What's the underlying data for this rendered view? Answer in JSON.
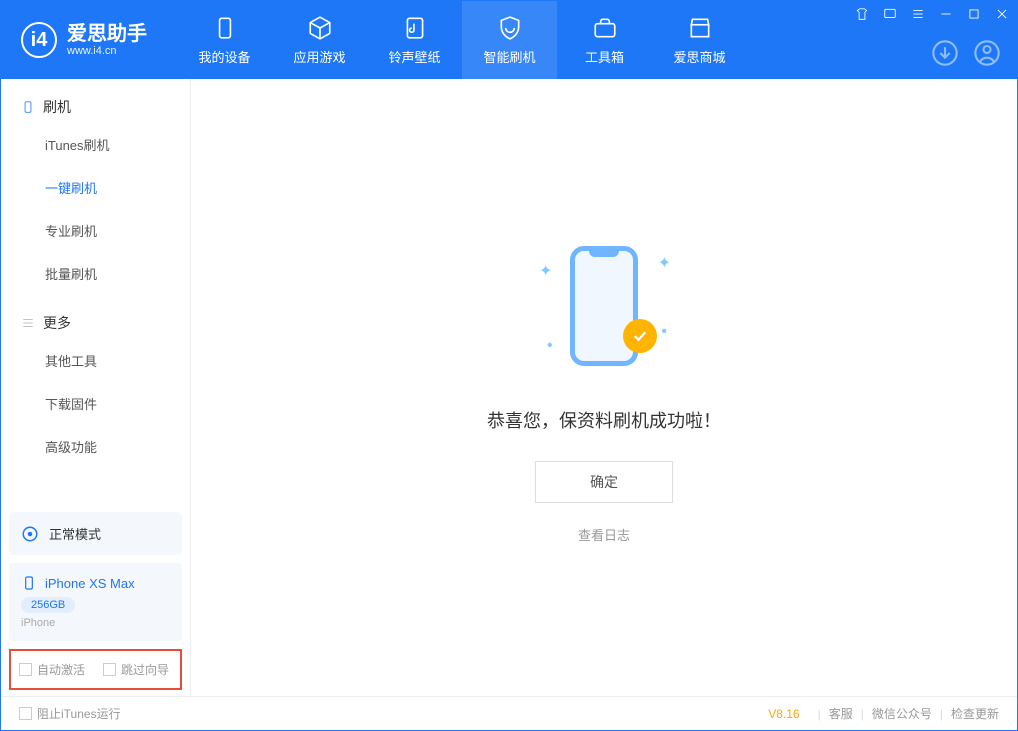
{
  "app": {
    "name": "爱思助手",
    "url": "www.i4.cn"
  },
  "tabs": [
    {
      "label": "我的设备"
    },
    {
      "label": "应用游戏"
    },
    {
      "label": "铃声壁纸"
    },
    {
      "label": "智能刷机"
    },
    {
      "label": "工具箱"
    },
    {
      "label": "爱思商城"
    }
  ],
  "sidebar": {
    "flash": {
      "title": "刷机",
      "items": [
        "iTunes刷机",
        "一键刷机",
        "专业刷机",
        "批量刷机"
      ]
    },
    "more": {
      "title": "更多",
      "items": [
        "其他工具",
        "下载固件",
        "高级功能"
      ]
    },
    "mode": "正常模式",
    "device": {
      "name": "iPhone XS Max",
      "storage": "256GB",
      "type": "iPhone"
    },
    "options": {
      "auto_activate": "自动激活",
      "skip_guide": "跳过向导"
    }
  },
  "main": {
    "success_msg": "恭喜您，保资料刷机成功啦！",
    "ok": "确定",
    "view_log": "查看日志"
  },
  "footer": {
    "block_itunes": "阻止iTunes运行",
    "version": "V8.16",
    "links": [
      "客服",
      "微信公众号",
      "检查更新"
    ]
  }
}
